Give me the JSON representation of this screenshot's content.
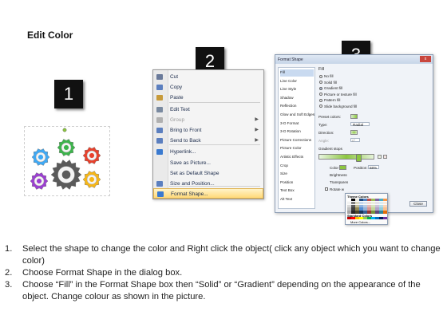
{
  "title": "Edit Color",
  "badges": [
    "1",
    "2",
    "3"
  ],
  "gears": {
    "colors": [
      "#3fa9f5",
      "#3cb44b",
      "#e8412c",
      "#9b3fd1",
      "#5a5a5a",
      "#f7b718"
    ]
  },
  "context_menu": {
    "items": [
      {
        "label": "Cut",
        "icon": "scissors-icon",
        "color": "#6a7a9a"
      },
      {
        "label": "Copy",
        "icon": "copy-icon",
        "color": "#5b7fbf"
      },
      {
        "label": "Paste",
        "icon": "clipboard-icon",
        "color": "#c79a3a"
      },
      {
        "label": "Edit Text",
        "icon": "edit-text-icon",
        "color": "#7a8aa0"
      },
      {
        "label": "Group",
        "icon": "group-icon",
        "color": "#b0b0b0",
        "disabled": true,
        "submenu": true
      },
      {
        "label": "Bring to Front",
        "icon": "bring-front-icon",
        "color": "#5b7fbf",
        "submenu": true
      },
      {
        "label": "Send to Back",
        "icon": "send-back-icon",
        "color": "#5b7fbf",
        "submenu": true
      },
      {
        "label": "Hyperlink...",
        "icon": "hyperlink-icon",
        "color": "#3a7ad0"
      },
      {
        "label": "Save as Picture...",
        "icon": "",
        "color": ""
      },
      {
        "label": "Set as Default Shape",
        "icon": "",
        "color": ""
      },
      {
        "label": "Size and Position...",
        "icon": "size-position-icon",
        "color": "#5b7fbf"
      },
      {
        "label": "Format Shape...",
        "icon": "format-shape-icon",
        "color": "#3a7ad0",
        "highlighted": true
      }
    ]
  },
  "dialog": {
    "title": "Format Shape",
    "close": "x",
    "nav": [
      "Fill",
      "Line Color",
      "Line Style",
      "Shadow",
      "Reflection",
      "Glow and Soft Edges",
      "3-D Format",
      "3-D Rotation",
      "Picture Corrections",
      "Picture Color",
      "Artistic Effects",
      "Crop",
      "Size",
      "Position",
      "Text Box",
      "Alt Text"
    ],
    "section": "Fill",
    "fill_options": [
      {
        "label": "No fill",
        "selected": false
      },
      {
        "label": "Solid fill",
        "selected": false
      },
      {
        "label": "Gradient fill",
        "selected": true
      },
      {
        "label": "Picture or texture fill",
        "selected": false
      },
      {
        "label": "Pattern fill",
        "selected": false
      },
      {
        "label": "Slide background fill",
        "selected": false
      }
    ],
    "preset_label": "Preset colors:",
    "type_label": "Type:",
    "type_value": "Radial",
    "direction_label": "Direction:",
    "angle_label": "Angle:",
    "angle_value": "0°",
    "stops_label": "Gradient stops",
    "color_label": "Color",
    "position_label": "Position:",
    "position_value": "68%",
    "brightness_label": "Brightness",
    "transparency_label": "Transparen",
    "rotate_label": "Rotate w",
    "close_button": "Close",
    "theme_colors_label": "Theme Colors",
    "standard_colors_label": "Standard Colors",
    "more_colors_label": "More Colors...",
    "accent": "#8cc63f"
  },
  "palette": {
    "theme_rows": [
      [
        "#ffffff",
        "#000000",
        "#eeece1",
        "#1f497d",
        "#4f81bd",
        "#c0504d",
        "#9bbb59",
        "#8064a2",
        "#4bacc6",
        "#f79646"
      ],
      [
        "#f2f2f2",
        "#7f7f7f",
        "#ddd9c3",
        "#c6d9f0",
        "#dbe5f1",
        "#f2dcdb",
        "#ebf1dd",
        "#e5e0ec",
        "#dbeef3",
        "#fdeada"
      ],
      [
        "#d8d8d8",
        "#595959",
        "#c4bd97",
        "#8db3e2",
        "#b8cce4",
        "#e5b9b7",
        "#d7e3bc",
        "#ccc1d9",
        "#b7dde8",
        "#fbd5b5"
      ],
      [
        "#bfbfbf",
        "#3f3f3f",
        "#938953",
        "#548dd4",
        "#95b3d7",
        "#d99694",
        "#c3d69b",
        "#b2a2c7",
        "#92cddc",
        "#fac08f"
      ],
      [
        "#a5a5a5",
        "#262626",
        "#494429",
        "#17365d",
        "#366092",
        "#953734",
        "#76923c",
        "#5f497a",
        "#31859b",
        "#e36c09"
      ]
    ],
    "standard_row": [
      "#c00000",
      "#ff0000",
      "#ffc000",
      "#ffff00",
      "#92d050",
      "#00b050",
      "#00b0f0",
      "#0070c0",
      "#002060",
      "#7030a0"
    ]
  },
  "instructions": [
    {
      "num": "1.",
      "text": "Select the shape to change the color and Right click the object( click any object which you want to change color)"
    },
    {
      "num": "2.",
      "text": "Choose Format Shape in the dialog box."
    },
    {
      "num": "3.",
      "text": "Choose “Fill” in the Format Shape box then “Solid” or “Gradient” depending on the appearance of the object. Change colour as shown in the picture."
    }
  ]
}
